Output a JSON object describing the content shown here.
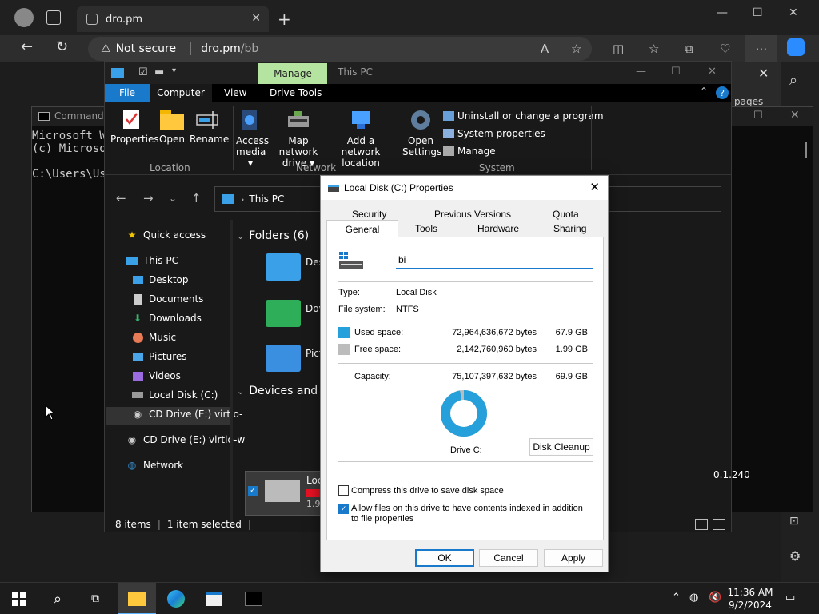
{
  "browser": {
    "tab_title": "dro.pm",
    "security_label": "Not secure",
    "url_host": "dro.pm",
    "url_path": "/bb",
    "page_fragment": "pages"
  },
  "cmd": {
    "title": "Command",
    "lines": [
      "Microsoft W",
      "(c) Microso",
      "",
      "C:\\Users\\Us"
    ]
  },
  "explorer": {
    "contextual_tab": "Manage",
    "title": "This PC",
    "ribbon_tabs": [
      "File",
      "Computer",
      "View",
      "Drive Tools"
    ],
    "location_buttons": [
      "Properties",
      "Open",
      "Rename"
    ],
    "network_buttons": [
      {
        "line1": "Access",
        "line2": "media ▾"
      },
      {
        "line1": "Map network",
        "line2": "drive ▾"
      },
      {
        "line1": "Add a network",
        "line2": "location"
      }
    ],
    "open_settings": {
      "line1": "Open",
      "line2": "Settings"
    },
    "system_items": [
      "Uninstall or change a program",
      "System properties",
      "Manage"
    ],
    "groups": [
      "Location",
      "Network",
      "System"
    ],
    "path": "This PC",
    "nav": {
      "quick_access": "Quick access",
      "this_pc": "This PC",
      "items": [
        "Desktop",
        "Documents",
        "Downloads",
        "Music",
        "Pictures",
        "Videos",
        "Local Disk (C:)",
        "CD Drive (E:) virtio-"
      ],
      "cd_drive": "CD Drive (E:) virtio-w",
      "network": "Network"
    },
    "content": {
      "folders_header": "Folders (6)",
      "folder_labels": [
        "Des",
        "Dov",
        "Pict"
      ],
      "devices_header": "Devices and d",
      "drive_label": "Loc",
      "drive_sub": "1.9",
      "right_text": "0.1.240"
    },
    "status": {
      "items": "8 items",
      "selected": "1 item selected"
    }
  },
  "props": {
    "title": "Local Disk (C:) Properties",
    "tabs_row1": [
      "Security",
      "Previous Versions",
      "Quota"
    ],
    "tabs_row2": [
      "General",
      "Tools",
      "Hardware",
      "Sharing"
    ],
    "name_value": "bi",
    "type_label": "Type:",
    "type_value": "Local Disk",
    "fs_label": "File system:",
    "fs_value": "NTFS",
    "used_label": "Used space:",
    "used_bytes": "72,964,636,672 bytes",
    "used_gb": "67.9 GB",
    "free_label": "Free space:",
    "free_bytes": "2,142,760,960 bytes",
    "free_gb": "1.99 GB",
    "cap_label": "Capacity:",
    "cap_bytes": "75,107,397,632 bytes",
    "cap_gb": "69.9 GB",
    "used_fraction": 0.9715,
    "drive_label": "Drive C:",
    "cleanup": "Disk Cleanup",
    "compress": "Compress this drive to save disk space",
    "index": "Allow files on this drive to have contents indexed in addition to file properties",
    "ok": "OK",
    "cancel": "Cancel",
    "apply": "Apply",
    "used_color": "#26a0da",
    "free_color": "#bcbcbc"
  },
  "taskbar": {
    "time": "11:36 AM",
    "date": "9/2/2024"
  }
}
